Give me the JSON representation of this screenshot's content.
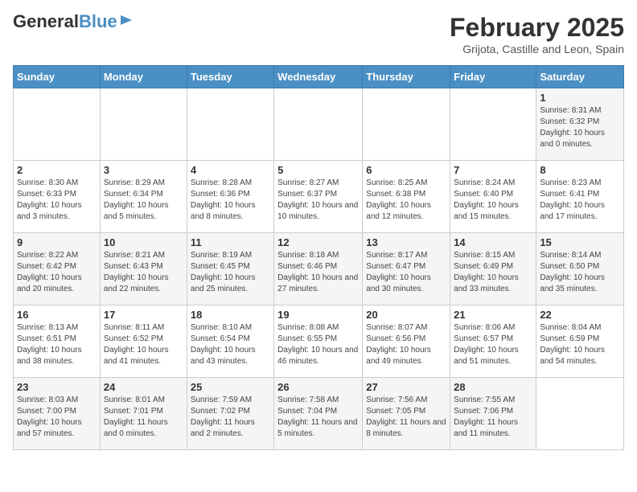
{
  "header": {
    "logo_general": "General",
    "logo_blue": "Blue",
    "title": "February 2025",
    "subtitle": "Grijota, Castille and Leon, Spain"
  },
  "calendar": {
    "weekdays": [
      "Sunday",
      "Monday",
      "Tuesday",
      "Wednesday",
      "Thursday",
      "Friday",
      "Saturday"
    ],
    "weeks": [
      [
        {
          "day": "",
          "info": ""
        },
        {
          "day": "",
          "info": ""
        },
        {
          "day": "",
          "info": ""
        },
        {
          "day": "",
          "info": ""
        },
        {
          "day": "",
          "info": ""
        },
        {
          "day": "",
          "info": ""
        },
        {
          "day": "1",
          "info": "Sunrise: 8:31 AM\nSunset: 6:32 PM\nDaylight: 10 hours and 0 minutes."
        }
      ],
      [
        {
          "day": "2",
          "info": "Sunrise: 8:30 AM\nSunset: 6:33 PM\nDaylight: 10 hours and 3 minutes."
        },
        {
          "day": "3",
          "info": "Sunrise: 8:29 AM\nSunset: 6:34 PM\nDaylight: 10 hours and 5 minutes."
        },
        {
          "day": "4",
          "info": "Sunrise: 8:28 AM\nSunset: 6:36 PM\nDaylight: 10 hours and 8 minutes."
        },
        {
          "day": "5",
          "info": "Sunrise: 8:27 AM\nSunset: 6:37 PM\nDaylight: 10 hours and 10 minutes."
        },
        {
          "day": "6",
          "info": "Sunrise: 8:25 AM\nSunset: 6:38 PM\nDaylight: 10 hours and 12 minutes."
        },
        {
          "day": "7",
          "info": "Sunrise: 8:24 AM\nSunset: 6:40 PM\nDaylight: 10 hours and 15 minutes."
        },
        {
          "day": "8",
          "info": "Sunrise: 8:23 AM\nSunset: 6:41 PM\nDaylight: 10 hours and 17 minutes."
        }
      ],
      [
        {
          "day": "9",
          "info": "Sunrise: 8:22 AM\nSunset: 6:42 PM\nDaylight: 10 hours and 20 minutes."
        },
        {
          "day": "10",
          "info": "Sunrise: 8:21 AM\nSunset: 6:43 PM\nDaylight: 10 hours and 22 minutes."
        },
        {
          "day": "11",
          "info": "Sunrise: 8:19 AM\nSunset: 6:45 PM\nDaylight: 10 hours and 25 minutes."
        },
        {
          "day": "12",
          "info": "Sunrise: 8:18 AM\nSunset: 6:46 PM\nDaylight: 10 hours and 27 minutes."
        },
        {
          "day": "13",
          "info": "Sunrise: 8:17 AM\nSunset: 6:47 PM\nDaylight: 10 hours and 30 minutes."
        },
        {
          "day": "14",
          "info": "Sunrise: 8:15 AM\nSunset: 6:49 PM\nDaylight: 10 hours and 33 minutes."
        },
        {
          "day": "15",
          "info": "Sunrise: 8:14 AM\nSunset: 6:50 PM\nDaylight: 10 hours and 35 minutes."
        }
      ],
      [
        {
          "day": "16",
          "info": "Sunrise: 8:13 AM\nSunset: 6:51 PM\nDaylight: 10 hours and 38 minutes."
        },
        {
          "day": "17",
          "info": "Sunrise: 8:11 AM\nSunset: 6:52 PM\nDaylight: 10 hours and 41 minutes."
        },
        {
          "day": "18",
          "info": "Sunrise: 8:10 AM\nSunset: 6:54 PM\nDaylight: 10 hours and 43 minutes."
        },
        {
          "day": "19",
          "info": "Sunrise: 8:08 AM\nSunset: 6:55 PM\nDaylight: 10 hours and 46 minutes."
        },
        {
          "day": "20",
          "info": "Sunrise: 8:07 AM\nSunset: 6:56 PM\nDaylight: 10 hours and 49 minutes."
        },
        {
          "day": "21",
          "info": "Sunrise: 8:06 AM\nSunset: 6:57 PM\nDaylight: 10 hours and 51 minutes."
        },
        {
          "day": "22",
          "info": "Sunrise: 8:04 AM\nSunset: 6:59 PM\nDaylight: 10 hours and 54 minutes."
        }
      ],
      [
        {
          "day": "23",
          "info": "Sunrise: 8:03 AM\nSunset: 7:00 PM\nDaylight: 10 hours and 57 minutes."
        },
        {
          "day": "24",
          "info": "Sunrise: 8:01 AM\nSunset: 7:01 PM\nDaylight: 11 hours and 0 minutes."
        },
        {
          "day": "25",
          "info": "Sunrise: 7:59 AM\nSunset: 7:02 PM\nDaylight: 11 hours and 2 minutes."
        },
        {
          "day": "26",
          "info": "Sunrise: 7:58 AM\nSunset: 7:04 PM\nDaylight: 11 hours and 5 minutes."
        },
        {
          "day": "27",
          "info": "Sunrise: 7:56 AM\nSunset: 7:05 PM\nDaylight: 11 hours and 8 minutes."
        },
        {
          "day": "28",
          "info": "Sunrise: 7:55 AM\nSunset: 7:06 PM\nDaylight: 11 hours and 11 minutes."
        },
        {
          "day": "",
          "info": ""
        }
      ]
    ]
  }
}
